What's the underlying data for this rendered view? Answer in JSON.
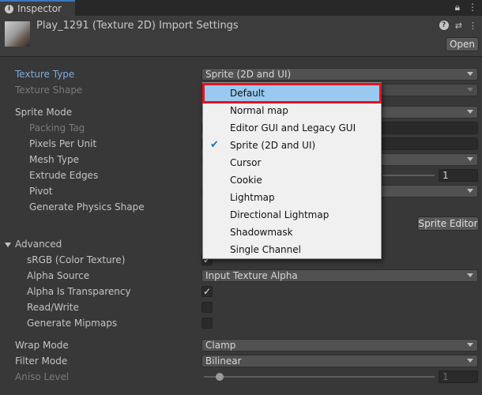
{
  "tab": {
    "title": "Inspector"
  },
  "header": {
    "title": "Play_1291 (Texture 2D) Import Settings",
    "open_label": "Open"
  },
  "rows": {
    "texture_type": {
      "label": "Texture Type",
      "value": "Sprite (2D and UI)"
    },
    "texture_shape": {
      "label": "Texture Shape"
    },
    "sprite_mode": {
      "label": "Sprite Mode"
    },
    "packing_tag": {
      "label": "Packing Tag"
    },
    "pixels_per_unit": {
      "label": "Pixels Per Unit"
    },
    "mesh_type": {
      "label": "Mesh Type"
    },
    "extrude_edges": {
      "label": "Extrude Edges",
      "value": "1"
    },
    "pivot": {
      "label": "Pivot"
    },
    "generate_physics_shape": {
      "label": "Generate Physics Shape"
    },
    "sprite_editor_label": "Sprite Editor"
  },
  "advanced": {
    "label": "Advanced",
    "srgb": {
      "label": "sRGB (Color Texture)"
    },
    "alpha_source": {
      "label": "Alpha Source",
      "value": "Input Texture Alpha"
    },
    "alpha_is_transparency": {
      "label": "Alpha Is Transparency",
      "checked": true
    },
    "read_write": {
      "label": "Read/Write",
      "checked": false
    },
    "generate_mipmaps": {
      "label": "Generate Mipmaps",
      "checked": false
    }
  },
  "wrap_mode": {
    "label": "Wrap Mode",
    "value": "Clamp"
  },
  "filter_mode": {
    "label": "Filter Mode",
    "value": "Bilinear"
  },
  "aniso_level": {
    "label": "Aniso Level",
    "value": "1"
  },
  "dropdown": {
    "items": [
      {
        "label": "Default",
        "highlighted": true,
        "checked": false
      },
      {
        "label": "Normal map",
        "checked": false
      },
      {
        "label": "Editor GUI and Legacy GUI",
        "checked": false
      },
      {
        "label": "Sprite (2D and UI)",
        "checked": true
      },
      {
        "label": "Cursor",
        "checked": false
      },
      {
        "label": "Cookie",
        "checked": false
      },
      {
        "label": "Lightmap",
        "checked": false
      },
      {
        "label": "Directional Lightmap",
        "checked": false
      },
      {
        "label": "Shadowmask",
        "checked": false
      },
      {
        "label": "Single Channel",
        "checked": false
      }
    ]
  },
  "colors": {
    "label_highlight": "#7babe3",
    "selection": "#99c9ef",
    "highlight_box": "#e3141f"
  }
}
